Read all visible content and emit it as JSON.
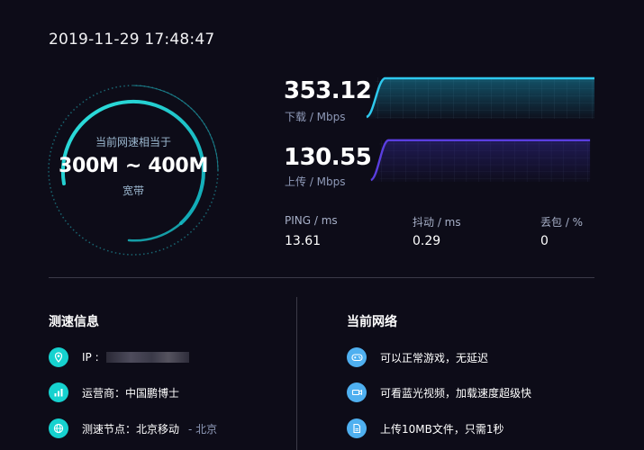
{
  "timestamp": "2019-11-29 17:48:47",
  "gauge": {
    "caption": "当前网速相当于",
    "range": "300M ~ 400M",
    "type": "宽带"
  },
  "download": {
    "value": "353.12",
    "label": "下载 / Mbps"
  },
  "upload": {
    "value": "130.55",
    "label": "上传 / Mbps"
  },
  "stats": [
    {
      "label": "PING / ms",
      "value": "13.61"
    },
    {
      "label": "抖动 / ms",
      "value": "0.29"
    },
    {
      "label": "丢包 / %",
      "value": "0"
    }
  ],
  "test_info": {
    "title": "测速信息",
    "ip_label": "IP :",
    "isp": "运营商：中国鹏博士",
    "node": "测速节点：北京移动",
    "node_location": "- 北京"
  },
  "network": {
    "title": "当前网络",
    "items": [
      "可以正常游戏，无延迟",
      "可看蓝光视频，加载速度超级快",
      "上传10MB文件，只需1秒"
    ]
  },
  "colors": {
    "background": "#0d0c18",
    "accent_teal": "#16d2cf",
    "accent_blue": "#4fb0f0",
    "download_line": "#2ec9ee",
    "upload_line": "#5a3ee0"
  }
}
